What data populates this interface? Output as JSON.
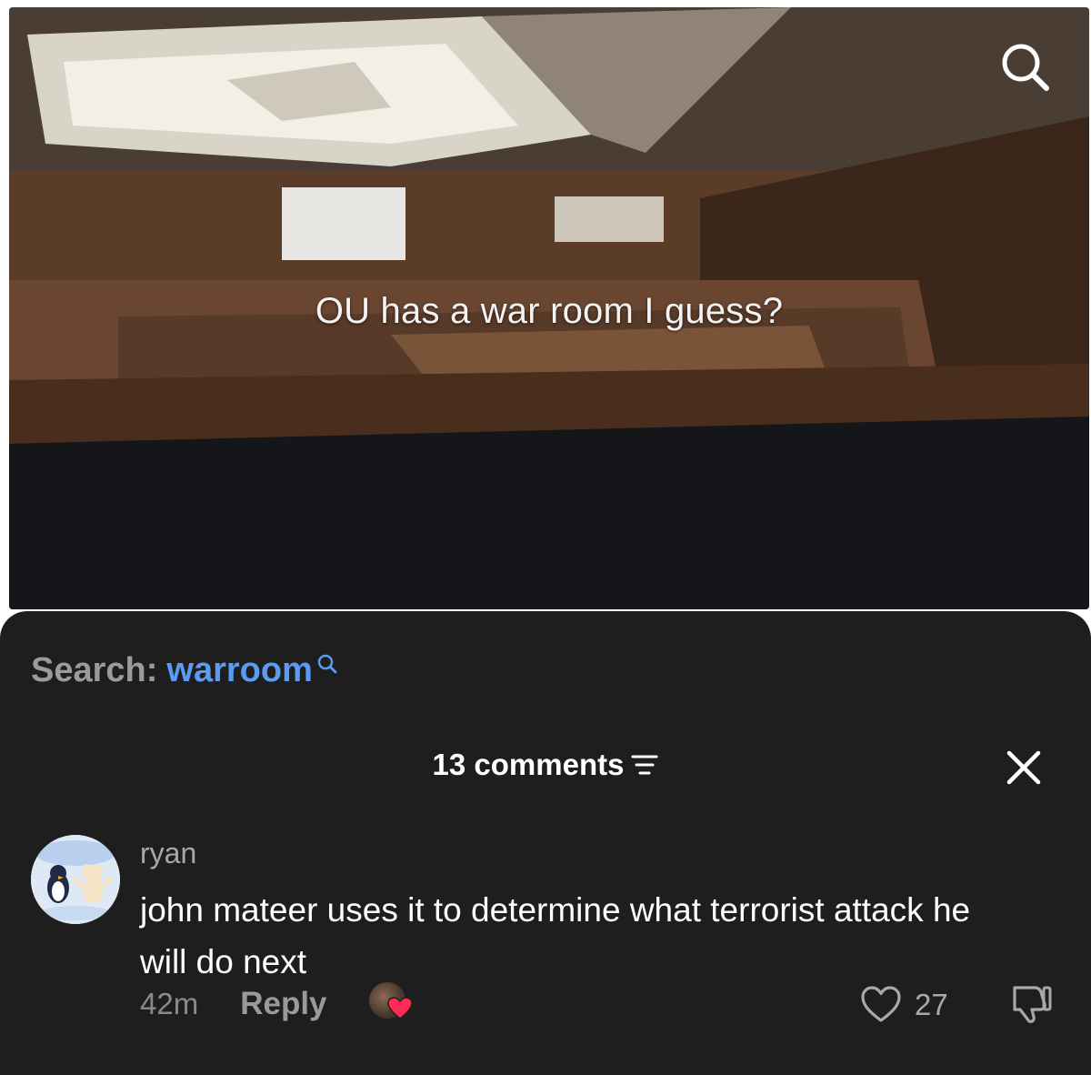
{
  "video": {
    "caption": "OU has a war room I guess?",
    "search_icon": "search-icon"
  },
  "sheet": {
    "search_prefix": "Search:",
    "search_term": "warroom",
    "search_term_icon": "search-icon",
    "comments_count_label": "13 comments",
    "filter_icon": "filter-icon",
    "close_icon": "close-icon"
  },
  "comment": {
    "username": "ryan",
    "text": "john mateer uses it to determine what terrorist attack he will do next",
    "time": "42m",
    "reply_label": "Reply",
    "creator_liked_icon": "heart-icon",
    "like_icon": "heart-outline-icon",
    "like_count": "27",
    "dislike_icon": "thumbs-down-icon"
  },
  "colors": {
    "sheet_bg": "#1e1e1e",
    "search_term": "#5b9bf2",
    "heart_badge": "#fe2c55",
    "muted_text": "#a8a8a8"
  }
}
